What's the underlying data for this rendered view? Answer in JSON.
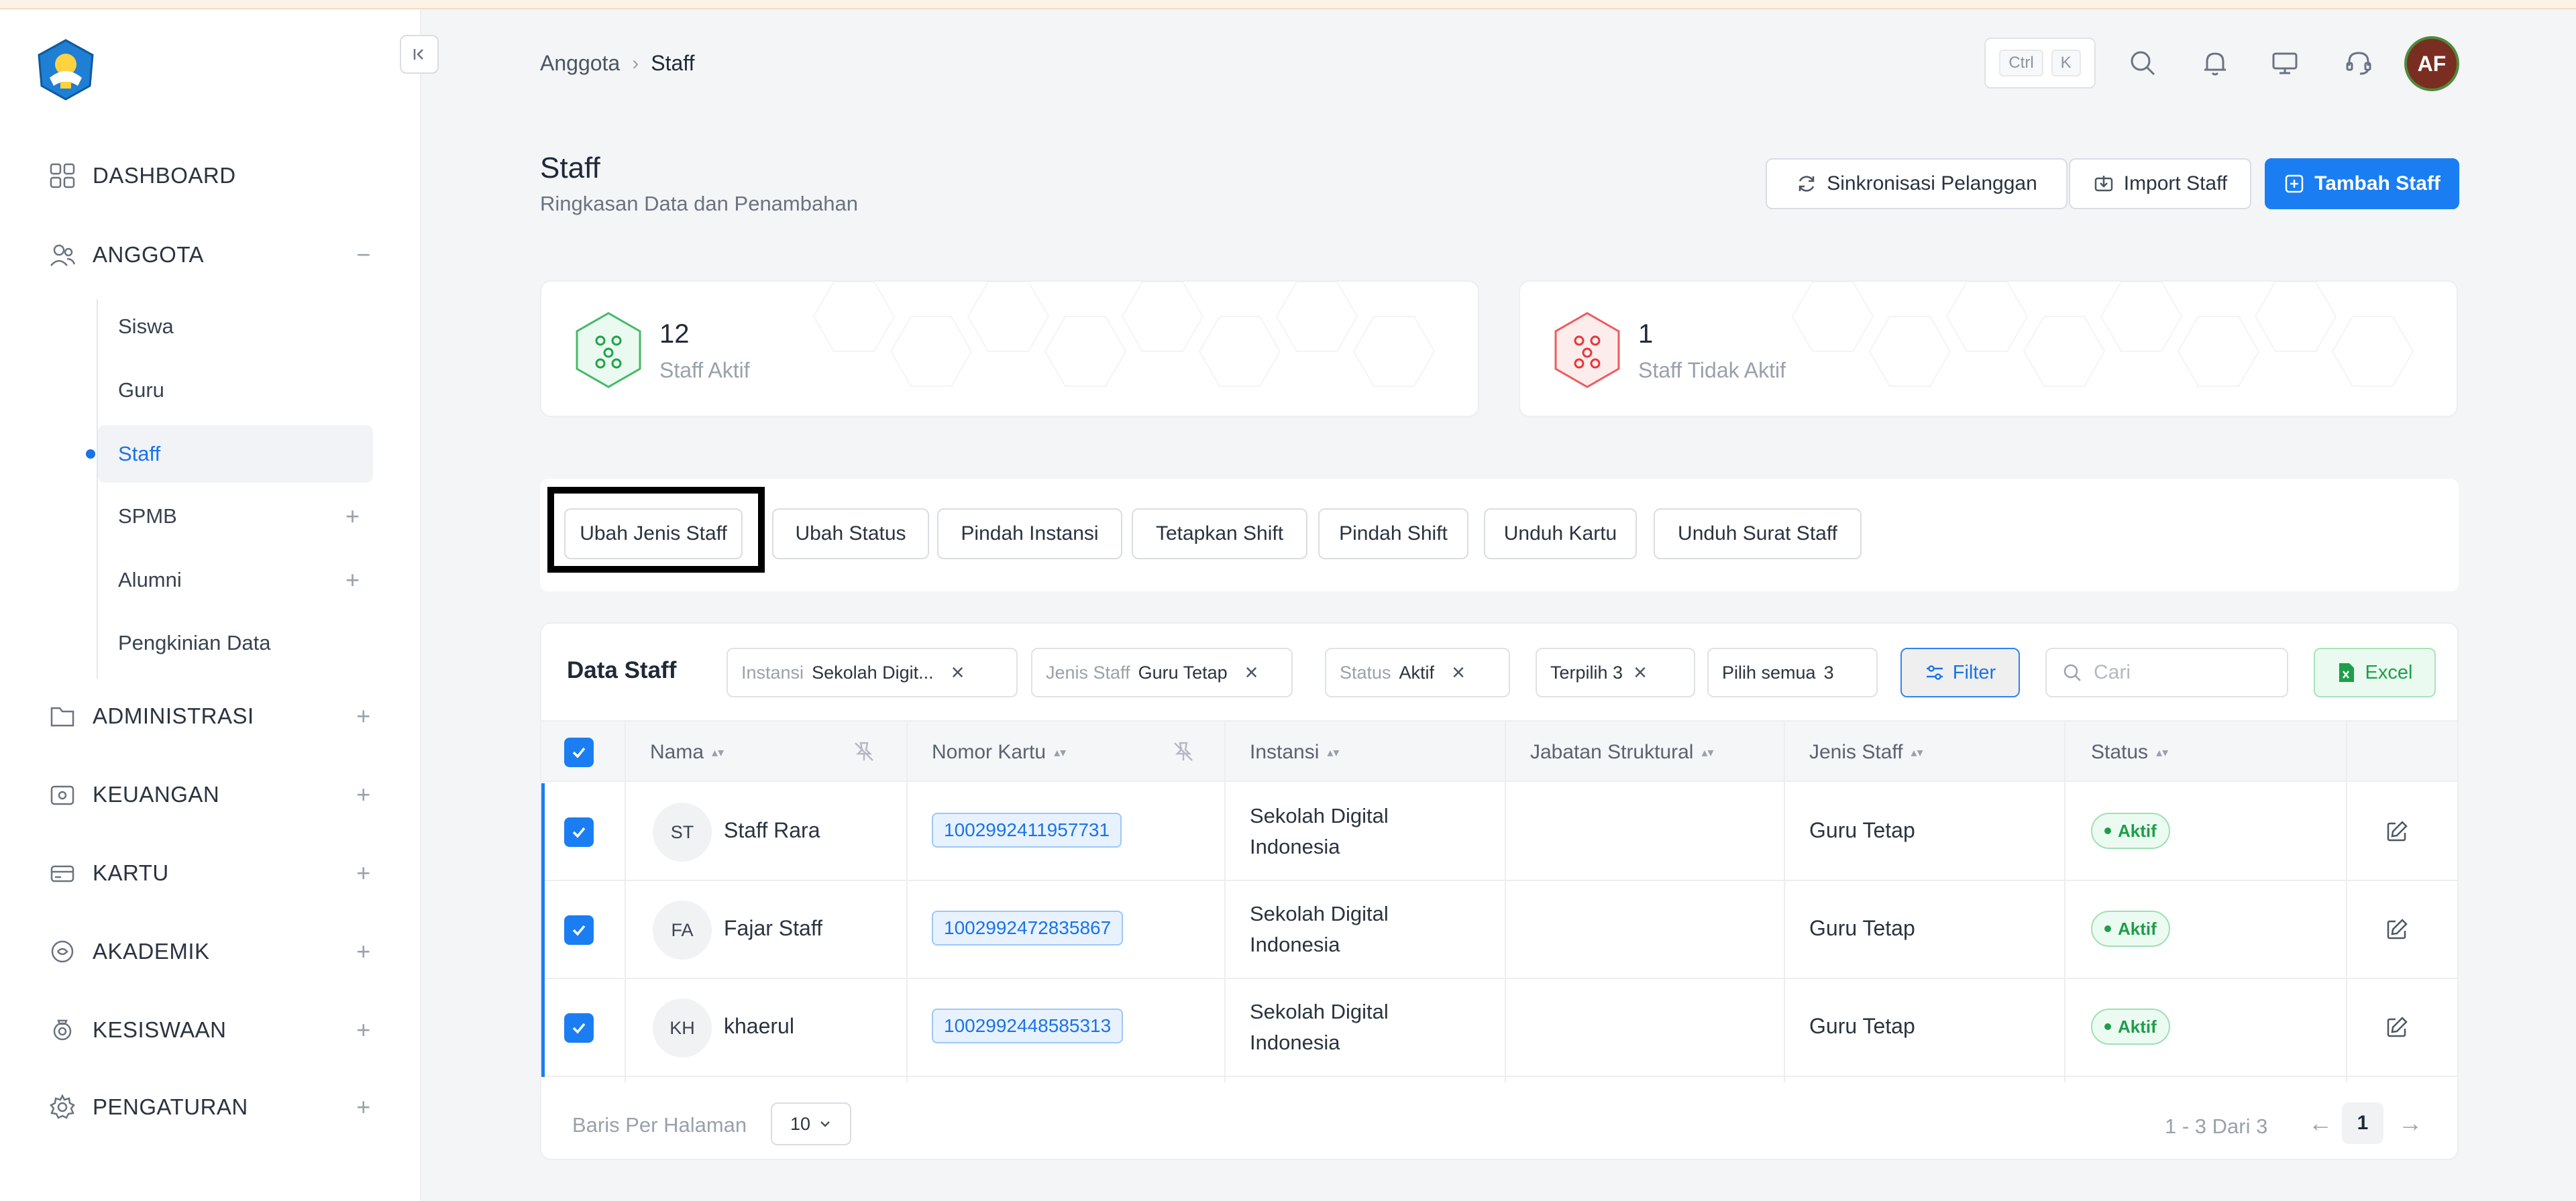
{
  "header": {
    "breadcrumb": [
      "Anggota",
      "Staff"
    ],
    "shortcut_keys": [
      "Ctrl",
      "K"
    ],
    "avatar_initials": "AF"
  },
  "sidebar": {
    "items": [
      {
        "label": "DASHBOARD",
        "icon": "dashboard-icon",
        "toggle": ""
      },
      {
        "label": "ANGGOTA",
        "icon": "users-icon",
        "toggle": "−"
      },
      {
        "label": "ADMINISTRASI",
        "icon": "folder-icon",
        "toggle": "+"
      },
      {
        "label": "KEUANGAN",
        "icon": "wallet-icon",
        "toggle": "+"
      },
      {
        "label": "KARTU",
        "icon": "card-icon",
        "toggle": "+"
      },
      {
        "label": "AKADEMIK",
        "icon": "academic-icon",
        "toggle": "+"
      },
      {
        "label": "KESISWAAN",
        "icon": "student-icon",
        "toggle": "+"
      },
      {
        "label": "PENGATURAN",
        "icon": "gear-icon",
        "toggle": "+"
      }
    ],
    "sub_items": [
      {
        "label": "Siswa",
        "toggle": ""
      },
      {
        "label": "Guru",
        "toggle": ""
      },
      {
        "label": "Staff",
        "toggle": "",
        "active": true
      },
      {
        "label": "SPMB",
        "toggle": "+"
      },
      {
        "label": "Alumni",
        "toggle": "+"
      },
      {
        "label": "Pengkinian Data",
        "toggle": ""
      }
    ]
  },
  "page": {
    "title": "Staff",
    "subtitle": "Ringkasan Data dan Penambahan",
    "buttons": {
      "sync": "Sinkronisasi Pelanggan",
      "import": "Import Staff",
      "add": "Tambah Staff"
    }
  },
  "stats": [
    {
      "value": "12",
      "label": "Staff Aktif",
      "color": "#22a34a"
    },
    {
      "value": "1",
      "label": "Staff Tidak Aktif",
      "color": "#e5383b"
    }
  ],
  "actions": [
    "Ubah Jenis Staff",
    "Ubah Status",
    "Pindah Instansi",
    "Tetapkan Shift",
    "Pindah Shift",
    "Unduh Kartu",
    "Unduh Surat Staff"
  ],
  "table": {
    "title": "Data Staff",
    "filters": [
      {
        "key": "Instansi",
        "value": "Sekolah Digit..."
      },
      {
        "key": "Jenis Staff",
        "value": "Guru Tetap"
      },
      {
        "key": "Status",
        "value": "Aktif"
      }
    ],
    "selected_label": "Terpilih 3",
    "select_all_label": "Pilih semua",
    "select_all_count": "3",
    "filter_label": "Filter",
    "search_placeholder": "Cari",
    "excel_label": "Excel",
    "columns": [
      "Nama",
      "Nomor Kartu",
      "Instansi",
      "Jabatan Struktural",
      "Jenis Staff",
      "Status"
    ],
    "rows": [
      {
        "initials": "ST",
        "name": "Staff Rara",
        "card": "1002992411957731",
        "instansi": "Sekolah Digital Indonesia",
        "jabatan": "",
        "jenis": "Guru Tetap",
        "status": "Aktif"
      },
      {
        "initials": "FA",
        "name": "Fajar Staff",
        "card": "1002992472835867",
        "instansi": "Sekolah Digital Indonesia",
        "jabatan": "",
        "jenis": "Guru Tetap",
        "status": "Aktif"
      },
      {
        "initials": "KH",
        "name": "khaerul",
        "card": "1002992448585313",
        "instansi": "Sekolah Digital Indonesia",
        "jabatan": "",
        "jenis": "Guru Tetap",
        "status": "Aktif"
      }
    ],
    "per_page_label": "Baris Per Halaman",
    "per_page_value": "10",
    "range_label": "1 - 3 Dari 3",
    "current_page": "1"
  }
}
